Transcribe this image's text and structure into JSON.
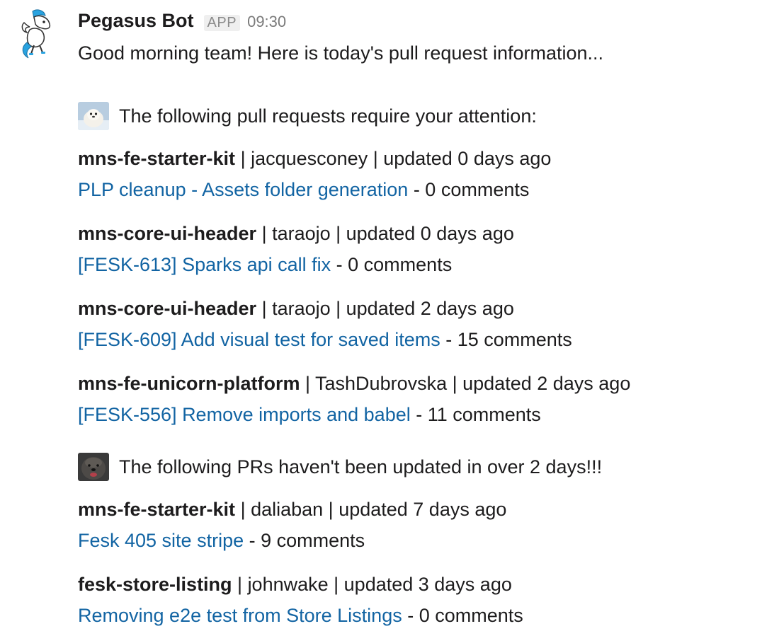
{
  "message": {
    "sender": "Pegasus Bot",
    "badge": "APP",
    "time": "09:30",
    "greeting": "Good morning team! Here is today's pull request information..."
  },
  "attention_section": {
    "icon": "seal-pup-icon",
    "title": "The following pull requests require your attention:",
    "prs": [
      {
        "repo": "mns-fe-starter-kit",
        "meta": " | jacquesconey | updated 0 days ago",
        "title": "PLP cleanup - Assets folder generation",
        "comments": " - 0 comments"
      },
      {
        "repo": "mns-core-ui-header",
        "meta": " | taraojo | updated 0 days ago",
        "title": "[FESK-613] Sparks api call fix",
        "comments": " - 0 comments"
      },
      {
        "repo": "mns-core-ui-header",
        "meta": " | taraojo | updated 2 days ago",
        "title": "[FESK-609] Add visual test for saved items",
        "comments": " - 15 comments"
      },
      {
        "repo": "mns-fe-unicorn-platform",
        "meta": " | TashDubrovska | updated 2 days ago",
        "title": "[FESK-556] Remove imports and babel",
        "comments": " - 11 comments"
      }
    ]
  },
  "stale_section": {
    "icon": "angry-dog-icon",
    "title": "The following PRs haven't been updated in over 2 days!!!",
    "prs": [
      {
        "repo": "mns-fe-starter-kit",
        "meta": " | daliaban | updated 7 days ago",
        "title": "Fesk 405 site stripe",
        "comments": " - 9 comments"
      },
      {
        "repo": "fesk-store-listing",
        "meta": " | johnwake | updated 3 days ago",
        "title": "Removing e2e test from Store Listings",
        "comments": " - 0 comments"
      }
    ]
  },
  "colors": {
    "link": "#1264a3",
    "text": "#1d1c1d",
    "muted": "#7a7a7a",
    "pegasus_blue": "#29a3e0"
  }
}
